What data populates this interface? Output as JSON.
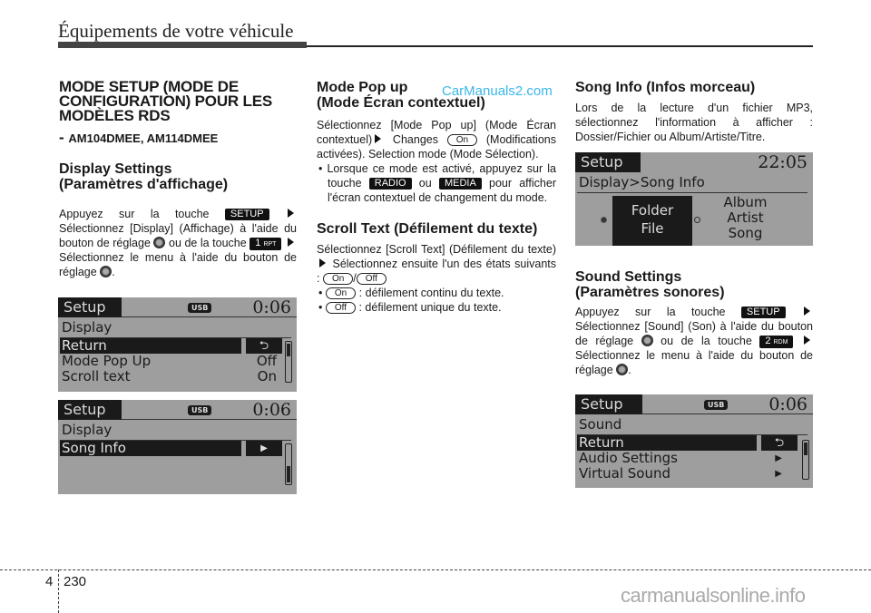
{
  "header": {
    "title": "Équipements de votre véhicule"
  },
  "col1": {
    "title_lines": [
      "MODE SETUP (MODE DE",
      "CONFIGURATION) POUR LES",
      "MODÈLES RDS"
    ],
    "models_dash": "- ",
    "models": "AM104DMEE, AM114DMEE",
    "display_title_1": "Display Settings",
    "display_title_2": "(Paramètres d'affichage)",
    "para": {
      "t1": "Appuyez sur la touche ",
      "key_setup": "SETUP",
      "t2": "Sélectionnez [Display] (Affichage) à l'aide du bouton de réglage ",
      "t3": " ou de la touche ",
      "key_1": "1",
      "key_1_sub": "RPT",
      "t4": " Sélectionnez le menu à l'aide du bouton de réglage ",
      "t5": "."
    },
    "screen1": {
      "tab": "Setup",
      "usb": "USB",
      "time": "0:06",
      "sub": "Display",
      "rows": [
        {
          "label": "Return",
          "value": "⮌",
          "selected": true
        },
        {
          "label": "Mode Pop Up",
          "value": "Off"
        },
        {
          "label": "Scroll text",
          "value": "On"
        }
      ]
    },
    "screen2": {
      "tab": "Setup",
      "usb": "USB",
      "time": "0:06",
      "sub": "Display",
      "rows": [
        {
          "label": "Song Info",
          "value": "▶",
          "selected": true
        }
      ]
    }
  },
  "col2": {
    "popup_title_1": "Mode Pop up",
    "popup_title_2": "(Mode Écran contextuel)",
    "popup_para": {
      "t1": "Sélectionnez [Mode Pop up] (Mode Écran contextuel)",
      "t2": " Changes ",
      "pill_on": "On",
      "t3": "(Modifications activées). Selection mode (Mode Sélection)."
    },
    "popup_bullet": {
      "t1": "Lorsque ce mode est activé, appuyez sur la touche ",
      "key_radio": "RADIO",
      "t2": " ou ",
      "key_media": "MEDIA",
      "t3": " pour afficher l'écran contextuel de changement du mode."
    },
    "scroll_title": "Scroll Text (Défilement du texte)",
    "scroll_para": {
      "t1": "Sélectionnez [Scroll Text] (Défilement du texte)",
      "t2": " Sélectionnez ensuite l'un des états suivants : ",
      "pill_on": "On",
      "sep": "/",
      "pill_off": "Off"
    },
    "scroll_bullets": [
      {
        "pill": "On",
        "text": " : défilement continu du texte."
      },
      {
        "pill": "Off",
        "text": " : défilement unique du texte."
      }
    ]
  },
  "col3": {
    "song_title": "Song Info (Infos morceau)",
    "song_para": "Lors de la lecture d'un fichier MP3, sélectionnez l'information à afficher : Dossier/Fichier ou Album/Artiste/Titre.",
    "screen3": {
      "tab": "Setup",
      "time": "22:05",
      "sub": "Display>Song Info",
      "option1": [
        "Folder",
        "File"
      ],
      "option2": [
        "Album",
        "Artist",
        "Song"
      ]
    },
    "sound_title_1": "Sound Settings",
    "sound_title_2": "(Paramètres sonores)",
    "sound_para": {
      "t1": "Appuyez sur la touche ",
      "key_setup": "SETUP",
      "t2": "Sélectionnez [Sound] (Son) à l'aide du bouton de réglage ",
      "t3": " ou de la touche ",
      "key_2": "2",
      "key_2_sub": "RDM",
      "t4": " Sélectionnez le menu à l'aide du bouton de réglage ",
      "t5": "."
    },
    "screen4": {
      "tab": "Setup",
      "usb": "USB",
      "time": "0:06",
      "sub": "Sound",
      "rows": [
        {
          "label": "Return",
          "value": "⮌",
          "selected": true
        },
        {
          "label": "Audio Settings",
          "value": "▶"
        },
        {
          "label": "Virtual Sound",
          "value": "▶"
        }
      ]
    }
  },
  "footer": {
    "chapter": "4",
    "page": "230"
  },
  "watermarks": {
    "top": "CarManuals2.com",
    "bottom": "carmanualsonline.info"
  }
}
